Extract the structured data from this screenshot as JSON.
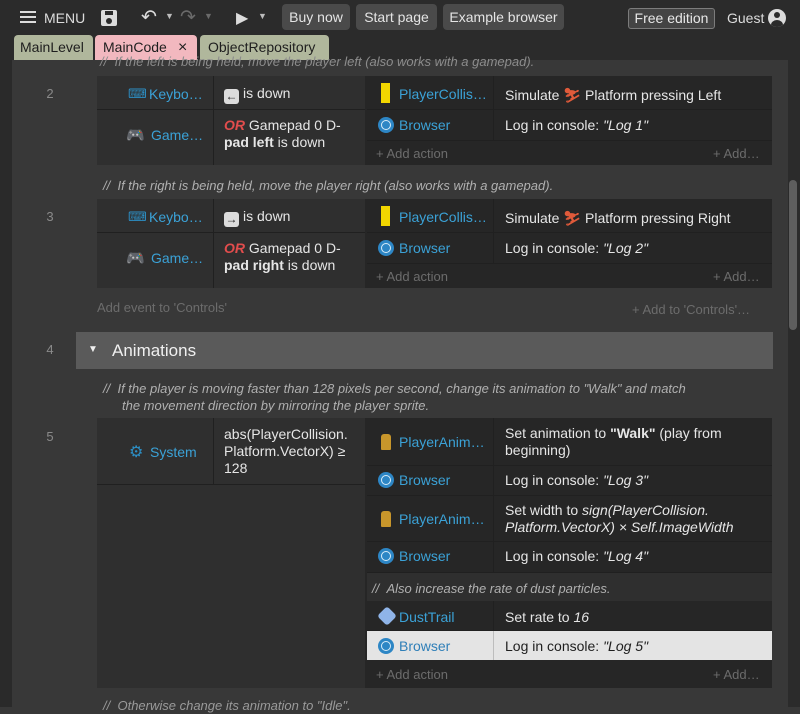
{
  "toolbar": {
    "menu_label": "MENU",
    "buy_now": "Buy now",
    "start_page": "Start page",
    "example_browser": "Example browser",
    "edition_badge": "Free edition",
    "guest_label": "Guest",
    "icons": [
      "hamburger-icon",
      "save-icon",
      "undo-icon",
      "redo-icon",
      "play-icon",
      "user-icon"
    ]
  },
  "tabs": [
    {
      "label": "MainLevel",
      "color": "#b0b79c"
    },
    {
      "label": "MainCode",
      "color": "#f2b8bf",
      "close": "×"
    },
    {
      "label": "ObjectRepository",
      "color": "#b0b79c"
    }
  ],
  "events": {
    "top_comment": "If the left is being held, move the player left (also works with a gamepad).",
    "e2": {
      "line": "2",
      "c1_obj": "Keybo…",
      "c1_key": "←",
      "c1_text": "is down",
      "c2_obj": "Game…",
      "c2_or": "OR",
      "c2_line1": "Gamepad 0 D-",
      "c2_line2_bold": "pad left",
      "c2_line2_rest": " is down",
      "a1_obj": "PlayerCollis…",
      "a1_pre": "Simulate",
      "a1_post": "Platform pressing Left",
      "a2_obj": "Browser",
      "a2_pre": "Log in console: ",
      "a2_val": "\"Log 1\"",
      "add_action": "+ Add action",
      "add_more": "+ Add…"
    },
    "comment_right": "If the right is being held, move the player right (also works with a gamepad).",
    "e3": {
      "line": "3",
      "c1_obj": "Keybo…",
      "c1_key": "→",
      "c1_text": "is down",
      "c2_obj": "Game…",
      "c2_or": "OR",
      "c2_line1": "Gamepad 0 D-",
      "c2_line2_bold": "pad right",
      "c2_line2_rest": " is down",
      "a1_obj": "PlayerCollis…",
      "a1_pre": "Simulate",
      "a1_post": "Platform pressing Right",
      "a2_obj": "Browser",
      "a2_pre": "Log in console: ",
      "a2_val": "\"Log 2\"",
      "add_action": "+ Add action",
      "add_more": "+ Add…"
    },
    "add_event": "Add event to 'Controls'",
    "add_to": "+ Add to 'Controls'…",
    "group": {
      "line": "4",
      "title": "Animations"
    },
    "anim_comment_1": "If the player is moving faster than 128 pixels per second, change its animation to \"Walk\" and match",
    "anim_comment_2": "the movement direction by mirroring the player sprite.",
    "e5": {
      "line": "5",
      "c_obj": "System",
      "c_line1": "abs(PlayerCollision.",
      "c_line2": "Platform.VectorX) ≥",
      "c_line3": "128",
      "a1_obj": "PlayerAnim…",
      "a1_pre": "Set animation to ",
      "a1_bold": "\"Walk\"",
      "a1_post": " (play from",
      "a1_line2": "beginning)",
      "a2_obj": "Browser",
      "a2_pre": "Log in console: ",
      "a2_val": "\"Log 3\"",
      "a3_obj": "PlayerAnim…",
      "a3_pre": "Set width to ",
      "a3_it1": "sign(PlayerCollision.",
      "a3_it2": "Platform.VectorX) × Self.ImageWidth",
      "a4_obj": "Browser",
      "a4_pre": "Log in console: ",
      "a4_val": "\"Log 4\"",
      "sub_comment": "Also increase the rate of dust particles.",
      "a5_obj": "DustTrail",
      "a5_pre": "Set rate to ",
      "a5_val": "16",
      "a6_obj": "Browser",
      "a6_pre": "Log in console: ",
      "a6_val": "\"Log 5\"",
      "add_action": "+ Add action",
      "add_more": "+ Add…"
    },
    "bottom_comment": "Otherwise change its animation to \"Idle\"."
  }
}
